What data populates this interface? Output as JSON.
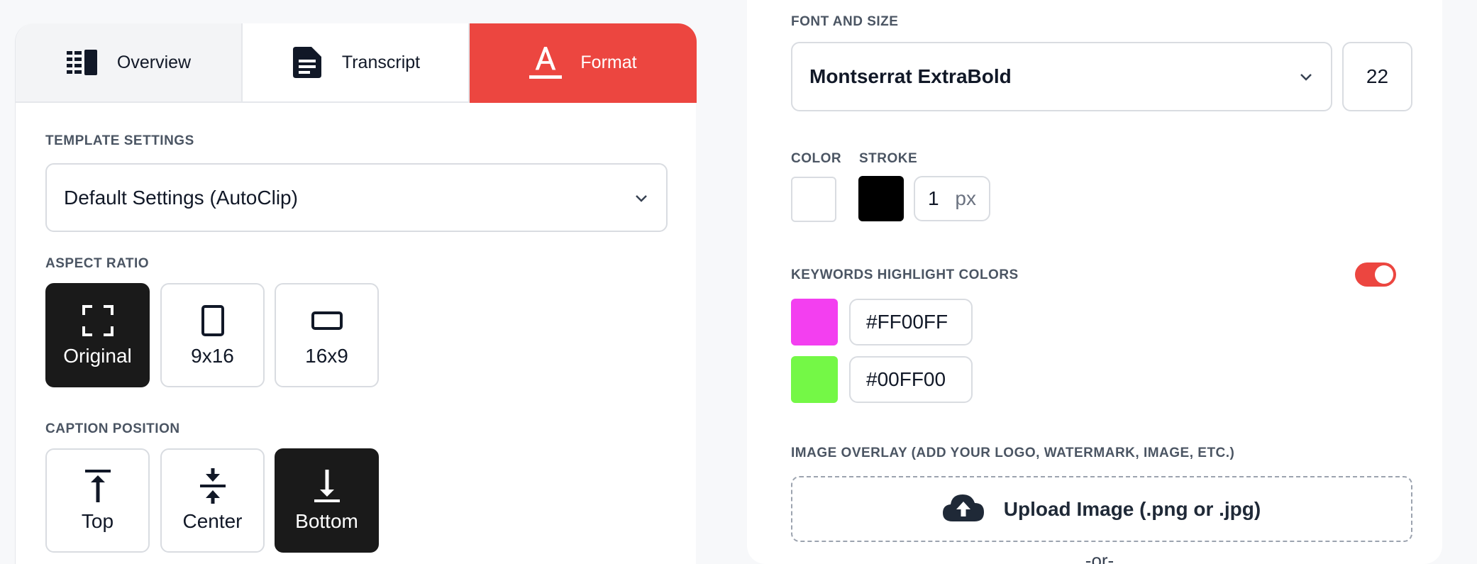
{
  "tabs": [
    {
      "label": "Overview",
      "icon": "overview-icon",
      "active": false
    },
    {
      "label": "Transcript",
      "icon": "document-icon",
      "active": false
    },
    {
      "label": "Format",
      "icon": "text-format-icon",
      "active": true
    }
  ],
  "template_settings": {
    "label": "TEMPLATE SETTINGS",
    "selected": "Default Settings (AutoClip)"
  },
  "aspect_ratio": {
    "label": "ASPECT RATIO",
    "options": [
      {
        "label": "Original",
        "icon": "fullscreen-icon",
        "active": true
      },
      {
        "label": "9x16",
        "icon": "portrait-icon",
        "active": false
      },
      {
        "label": "16x9",
        "icon": "landscape-icon",
        "active": false
      }
    ]
  },
  "caption_position": {
    "label": "CAPTION POSITION",
    "options": [
      {
        "label": "Top",
        "icon": "align-top-icon",
        "active": false
      },
      {
        "label": "Center",
        "icon": "align-center-icon",
        "active": false
      },
      {
        "label": "Bottom",
        "icon": "align-bottom-icon",
        "active": true
      }
    ]
  },
  "font": {
    "label": "FONT AND SIZE",
    "family": "Montserrat ExtraBold",
    "size": "22"
  },
  "color": {
    "label": "COLOR",
    "value": "#FFFFFF"
  },
  "stroke": {
    "label": "STROKE",
    "color": "#000000",
    "width": "1",
    "unit": "px"
  },
  "keywords": {
    "label": "KEYWORDS HIGHLIGHT COLORS",
    "enabled": true,
    "colors": [
      {
        "hex": "#FF00FF",
        "swatch": "#f33ff0"
      },
      {
        "hex": "#00FF00",
        "swatch": "#74f846"
      }
    ]
  },
  "image_overlay": {
    "label": "IMAGE OVERLAY (ADD YOUR LOGO, WATERMARK, IMAGE, ETC.)",
    "upload_label": "Upload Image (.png or .jpg)",
    "or_text": "-or-"
  },
  "colors": {
    "accent": "#ec4640",
    "dark": "#1a1a1a",
    "border": "#d9dce1"
  }
}
